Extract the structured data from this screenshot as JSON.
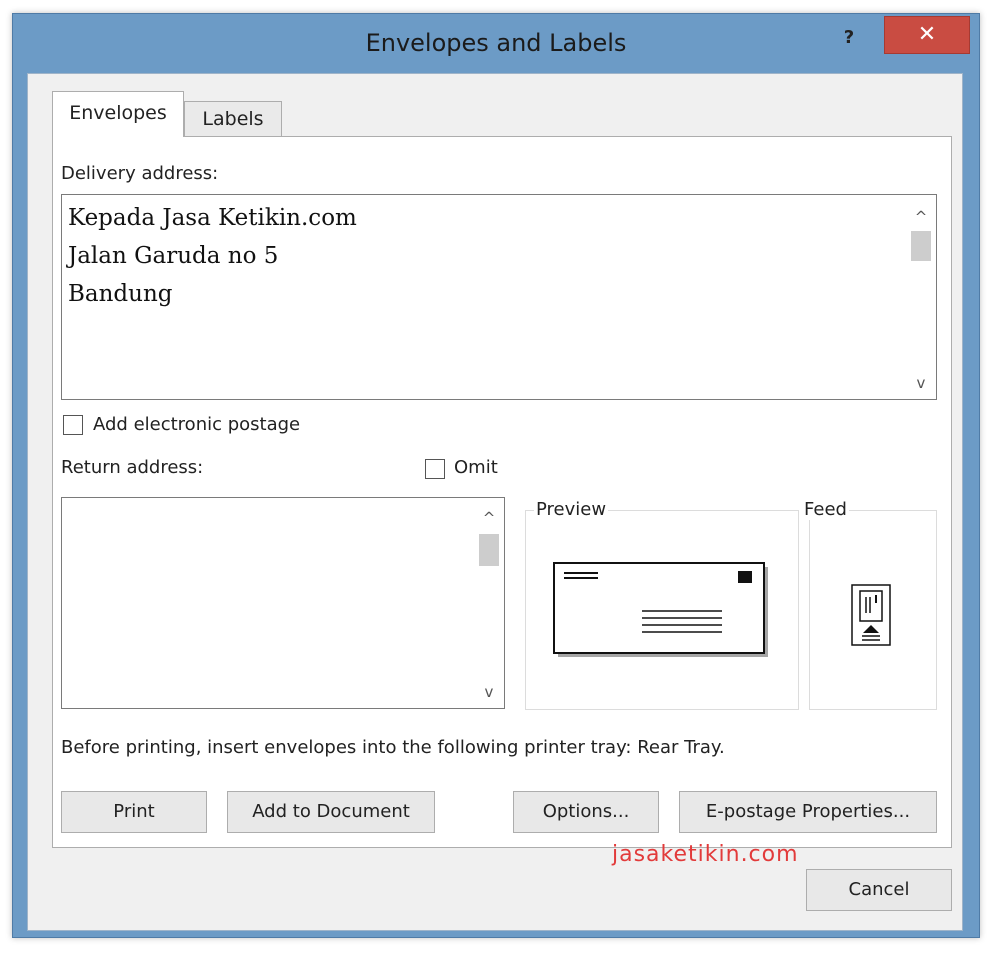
{
  "window": {
    "title": "Envelopes and Labels",
    "help_label": "?",
    "close_label": "✕"
  },
  "tabs": [
    {
      "label": "Envelopes",
      "selected": true
    },
    {
      "label": "Labels",
      "selected": false
    }
  ],
  "delivery": {
    "label": "Delivery address:",
    "lines": [
      "Kepada Jasa Ketikin.com",
      "Jalan Garuda no 5",
      "Bandung"
    ]
  },
  "postage": {
    "label": "Add electronic postage",
    "checked": false
  },
  "return_address": {
    "label": "Return address:",
    "value": "",
    "omit_label": "Omit",
    "omit_checked": false
  },
  "preview": {
    "label": "Preview"
  },
  "feed": {
    "label": "Feed"
  },
  "scroll": {
    "up": "^",
    "down": "v"
  },
  "printer_note": "Before printing, insert envelopes into the following printer tray: Rear Tray.",
  "buttons": {
    "print": "Print",
    "add_to_document": "Add to Document",
    "options": "Options...",
    "epostage": "E-postage Properties...",
    "cancel": "Cancel"
  },
  "watermark": "jasaketikin.com",
  "colors": {
    "title_bar": "#6c9bc6",
    "close_button": "#c94c42",
    "watermark": "#e23a3a"
  }
}
